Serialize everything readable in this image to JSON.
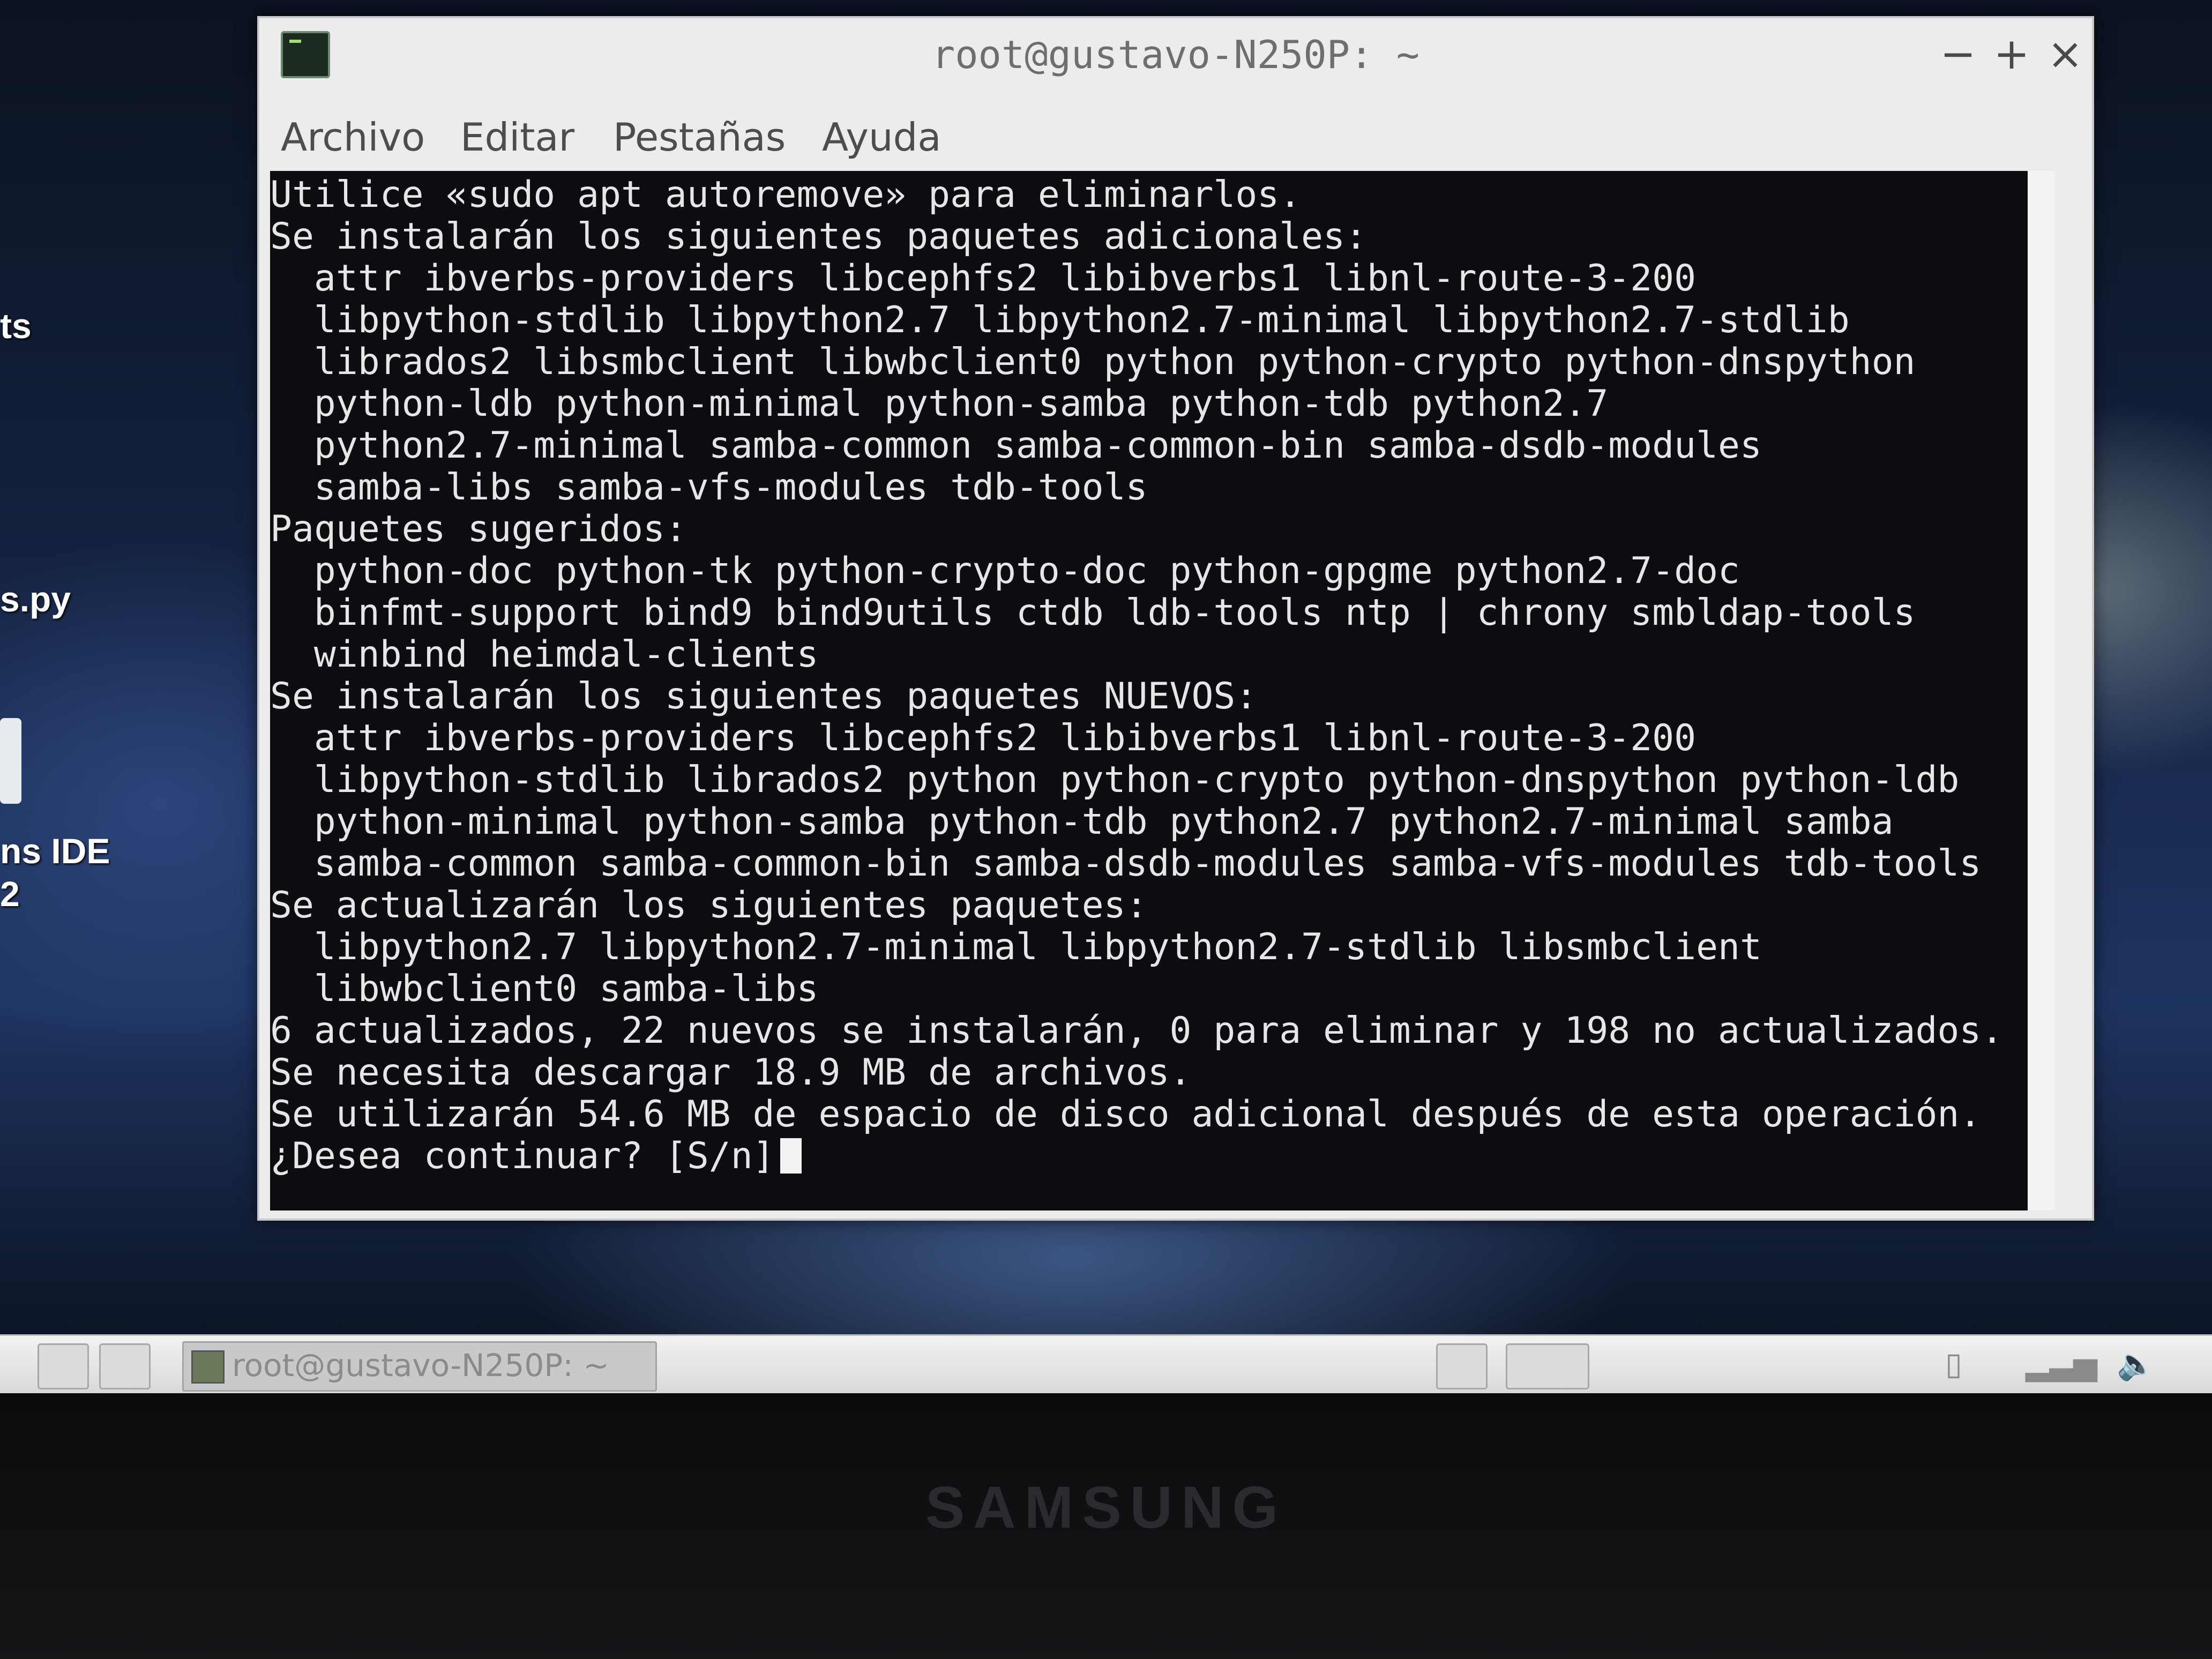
{
  "desktop": {
    "labels": [
      "ts",
      "s.py",
      "ns IDE",
      "2"
    ]
  },
  "window": {
    "title": "root@gustavo-N250P: ~",
    "controls": {
      "minimize": "−",
      "maximize": "+",
      "close": "×"
    },
    "menu": [
      "Archivo",
      "Editar",
      "Pestañas",
      "Ayuda"
    ]
  },
  "terminal": {
    "lines": [
      "Utilice «sudo apt autoremove» para eliminarlos.",
      "Se instalarán los siguientes paquetes adicionales:",
      "  attr ibverbs-providers libcephfs2 libibverbs1 libnl-route-3-200",
      "  libpython-stdlib libpython2.7 libpython2.7-minimal libpython2.7-stdlib",
      "  librados2 libsmbclient libwbclient0 python python-crypto python-dnspython",
      "  python-ldb python-minimal python-samba python-tdb python2.7",
      "  python2.7-minimal samba-common samba-common-bin samba-dsdb-modules",
      "  samba-libs samba-vfs-modules tdb-tools",
      "Paquetes sugeridos:",
      "  python-doc python-tk python-crypto-doc python-gpgme python2.7-doc",
      "  binfmt-support bind9 bind9utils ctdb ldb-tools ntp | chrony smbldap-tools",
      "  winbind heimdal-clients",
      "Se instalarán los siguientes paquetes NUEVOS:",
      "  attr ibverbs-providers libcephfs2 libibverbs1 libnl-route-3-200",
      "  libpython-stdlib librados2 python python-crypto python-dnspython python-ldb",
      "  python-minimal python-samba python-tdb python2.7 python2.7-minimal samba",
      "  samba-common samba-common-bin samba-dsdb-modules samba-vfs-modules tdb-tools",
      "Se actualizarán los siguientes paquetes:",
      "  libpython2.7 libpython2.7-minimal libpython2.7-stdlib libsmbclient",
      "  libwbclient0 samba-libs",
      "6 actualizados, 22 nuevos se instalarán, 0 para eliminar y 198 no actualizados.",
      "Se necesita descargar 18.9 MB de archivos.",
      "Se utilizarán 54.6 MB de espacio de disco adicional después de esta operación."
    ],
    "prompt": "¿Desea continuar? [S/n]"
  },
  "taskbar": {
    "task_label": "root@gustavo-N250P: ~"
  },
  "bezel": {
    "brand": "SAMSUNG"
  },
  "colors": {
    "terminal_bg": "#0b0d10",
    "terminal_fg": "#e6e6e6",
    "window_chrome": "#ececec"
  }
}
